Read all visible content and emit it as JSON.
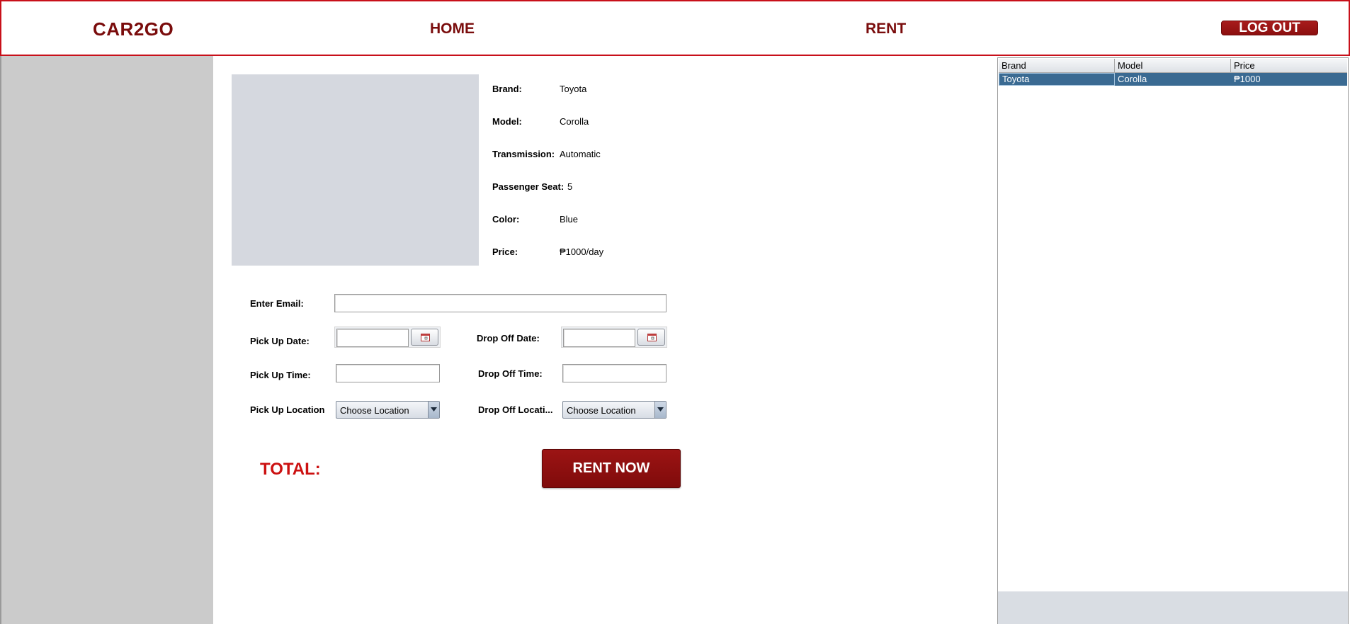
{
  "header": {
    "brand": "CAR2GO",
    "nav_home": "HOME",
    "nav_rent": "RENT",
    "logout_label": "LOG OUT"
  },
  "car_details": [
    {
      "label": "Brand:",
      "value": "Toyota"
    },
    {
      "label": "Model:",
      "value": "Corolla"
    },
    {
      "label": "Transmission:",
      "value": "Automatic"
    },
    {
      "label": "Passenger Seat:",
      "value": "5"
    },
    {
      "label": "Color:",
      "value": "Blue"
    },
    {
      "label": "Price:",
      "value": "₱1000/day"
    }
  ],
  "form": {
    "email_label": "Enter Email:",
    "email_value": "",
    "pickup_date_label": "Pick Up Date:",
    "pickup_date_value": "",
    "dropoff_date_label": "Drop Off Date:",
    "dropoff_date_value": "",
    "pickup_time_label": "Pick Up Time:",
    "pickup_time_value": "",
    "dropoff_time_label": "Drop Off Time:",
    "dropoff_time_value": "",
    "pickup_location_label": "Pick Up Location",
    "pickup_location_selected": "Choose Location",
    "dropoff_location_label": "Drop Off Locati...",
    "dropoff_location_selected": "Choose Location"
  },
  "summary": {
    "total_label": "TOTAL:",
    "rent_now_label": "RENT NOW"
  },
  "car_table": {
    "columns": [
      "Brand",
      "Model",
      "Price"
    ],
    "rows": [
      {
        "brand": "Toyota",
        "model": "Corolla",
        "price": "₱1000",
        "selected": true
      }
    ]
  },
  "colors": {
    "accent_dark_red": "#7a0c0c",
    "button_red": "#8c0f0f",
    "total_red": "#cc1111",
    "selected_row": "#3a6a92",
    "sidebar_gray": "#cbcbcb"
  }
}
